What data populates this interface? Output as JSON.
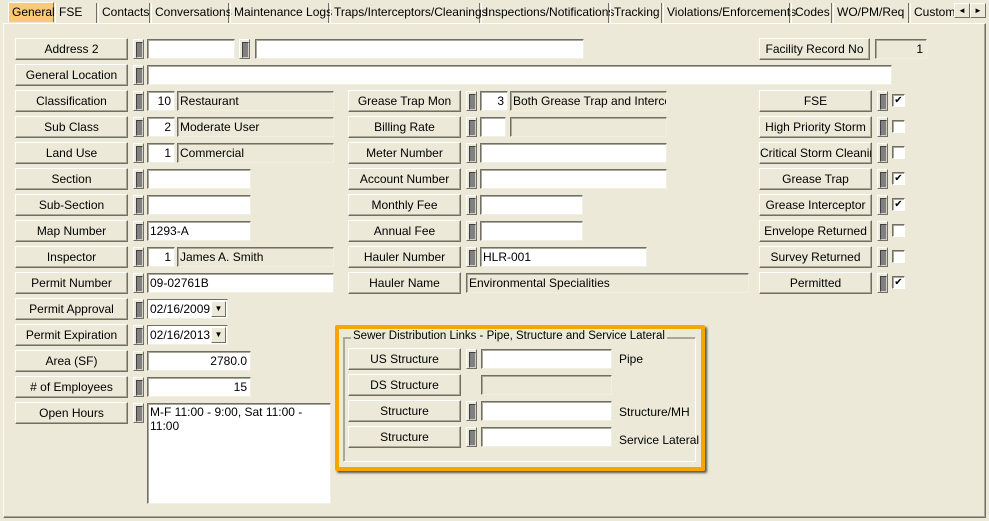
{
  "tabs": [
    {
      "label": "General",
      "active": true
    },
    {
      "label": "FSE"
    },
    {
      "label": "Contacts"
    },
    {
      "label": "Conversations"
    },
    {
      "label": "Maintenance Logs"
    },
    {
      "label": "Traps/Interceptors/Cleanings"
    },
    {
      "label": "Inspections/Notifications"
    },
    {
      "label": "Tracking"
    },
    {
      "label": "Violations/Enforcements"
    },
    {
      "label": "Codes"
    },
    {
      "label": "WO/PM/Req"
    },
    {
      "label": "Custom"
    }
  ],
  "tab_scroll": {
    "left_icon": "◄",
    "right_icon": "►"
  },
  "left": {
    "address2": {
      "label": "Address 2",
      "value1": "",
      "value2": ""
    },
    "general_location": {
      "label": "General Location",
      "value": ""
    },
    "classification": {
      "label": "Classification",
      "code": "10",
      "desc": "Restaurant"
    },
    "sub_class": {
      "label": "Sub Class",
      "code": "2",
      "desc": "Moderate User"
    },
    "land_use": {
      "label": "Land Use",
      "code": "1",
      "desc": "Commercial"
    },
    "section": {
      "label": "Section",
      "value": ""
    },
    "sub_section": {
      "label": "Sub-Section",
      "value": ""
    },
    "map_number": {
      "label": "Map Number",
      "value": "1293-A"
    },
    "inspector": {
      "label": "Inspector",
      "code": "1",
      "desc": "James A. Smith"
    },
    "permit_number": {
      "label": "Permit Number",
      "value": "09-02761B"
    },
    "permit_approval": {
      "label": "Permit Approval",
      "value": "02/16/2009"
    },
    "permit_expiration": {
      "label": "Permit Expiration",
      "value": "02/16/2013"
    },
    "area": {
      "label": "Area (SF)",
      "value": "2780.0"
    },
    "employees": {
      "label": "# of Employees",
      "value": "15"
    },
    "open_hours": {
      "label": "Open Hours",
      "value": "M-F 11:00 - 9:00, Sat 11:00 - 11:00"
    }
  },
  "middle": {
    "grease_trap_mon": {
      "label": "Grease Trap Mon",
      "code": "3",
      "desc": "Both Grease Trap and Intercept"
    },
    "billing_rate": {
      "label": "Billing Rate",
      "code": "",
      "desc": ""
    },
    "meter_number": {
      "label": "Meter Number",
      "value": ""
    },
    "account_number": {
      "label": "Account Number",
      "value": ""
    },
    "monthly_fee": {
      "label": "Monthly Fee",
      "value": ""
    },
    "annual_fee": {
      "label": "Annual Fee",
      "value": ""
    },
    "hauler_number": {
      "label": "Hauler Number",
      "value": "HLR-001"
    },
    "hauler_name": {
      "label": "Hauler Name",
      "value": "Environmental Specialities"
    }
  },
  "right": {
    "facility_record_no": {
      "label": "Facility Record No",
      "value": "1"
    },
    "checks": [
      {
        "label": "FSE",
        "checked": true
      },
      {
        "label": "High Priority Storm",
        "checked": false
      },
      {
        "label": "Critical Storm Cleaning",
        "checked": false
      },
      {
        "label": "Grease Trap",
        "checked": true
      },
      {
        "label": "Grease Interceptor",
        "checked": true
      },
      {
        "label": "Envelope Returned",
        "checked": false
      },
      {
        "label": "Survey Returned",
        "checked": false
      },
      {
        "label": "Permitted",
        "checked": true
      }
    ]
  },
  "sewer_group": {
    "title": "Sewer Distribution Links - Pipe, Structure and Service Lateral",
    "highlight_color": "#f7a600",
    "rows": [
      {
        "label": "US Structure",
        "value": "",
        "suffix": "Pipe"
      },
      {
        "label": "DS Structure",
        "value": "",
        "suffix": ""
      },
      {
        "label": "Structure",
        "value": "",
        "suffix": "Structure/MH"
      },
      {
        "label": "Structure",
        "value": "",
        "suffix": "Service Lateral"
      }
    ]
  },
  "icons": {
    "checkmark": "✔",
    "dropdown": "▼"
  }
}
